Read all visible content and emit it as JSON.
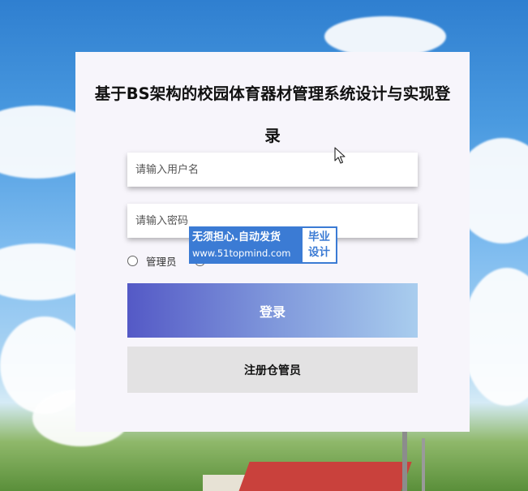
{
  "page": {
    "title": "基于BS架构的校园体育器材管理系统设计与实现登录"
  },
  "form": {
    "username_placeholder": "请输入用户名",
    "password_placeholder": "请输入密码",
    "roles": [
      {
        "label": "管理员",
        "selected": false
      },
      {
        "label": "",
        "selected": false
      }
    ],
    "login_label": "登录",
    "register_label": "注册仓管员"
  },
  "watermark": {
    "line1": "无须担心.自动发货",
    "line2": "www.51topmind.com",
    "badge_line1": "毕业",
    "badge_line2": "设计"
  },
  "colors": {
    "login_gradient_start": "#5459c6",
    "login_gradient_end": "#a9cdee",
    "register_bg": "#e3e2e3",
    "card_bg": "#f7f5fb",
    "watermark_blue": "#3b7bd4"
  },
  "icons": {
    "cursor": "mouse-pointer-icon"
  }
}
